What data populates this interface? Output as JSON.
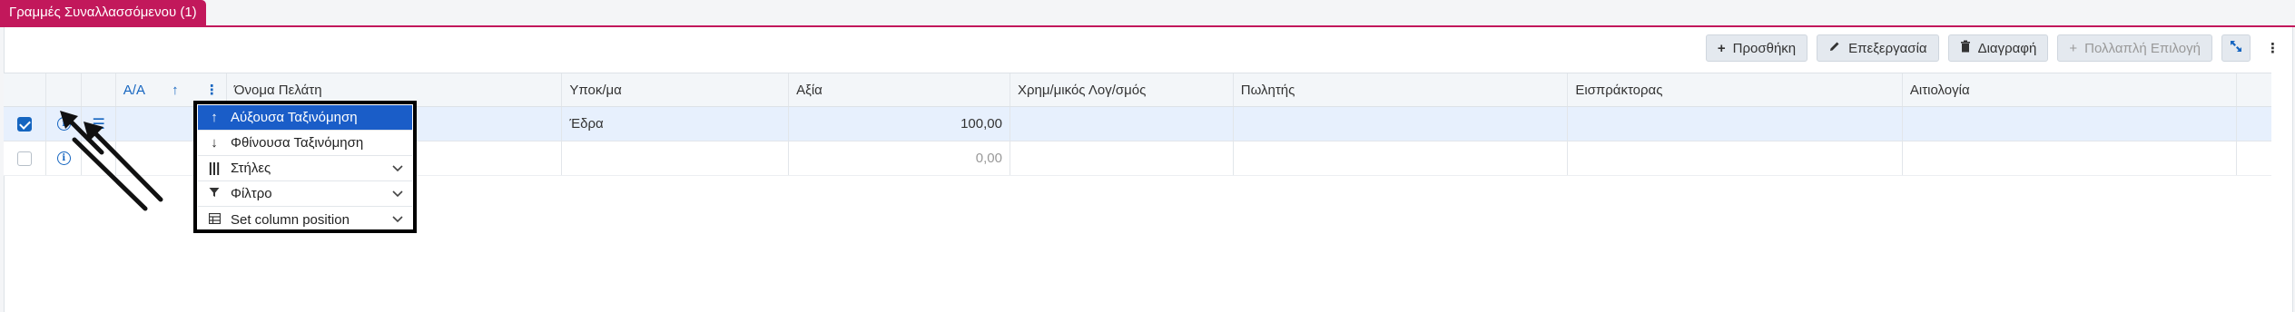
{
  "tab": {
    "label": "Γραμμές Συναλλασσόμενου (1)"
  },
  "toolbar": {
    "add_label": "Προσθήκη",
    "edit_label": "Επεξεργασία",
    "delete_label": "Διαγραφή",
    "multiselect_label": "Πολλαπλή Επιλογή"
  },
  "grid": {
    "headers": {
      "aa": "Α/Α",
      "customer_name": "Όνομα Πελάτη",
      "branch": "Υποκ/μα",
      "value": "Αξία",
      "financial_account": "Χρημ/μικός Λογ/σμός",
      "seller": "Πωλητής",
      "collector": "Εισπράκτορας",
      "reason": "Αιτιολογία"
    },
    "rows": [
      {
        "selected": true,
        "branch": "Έδρα",
        "value": "100,00"
      },
      {
        "selected": false,
        "branch": "",
        "value": "0,00"
      }
    ]
  },
  "column_menu": {
    "items": [
      {
        "label": "Αύξουσα Ταξινόμηση",
        "icon": "arrow-up-icon"
      },
      {
        "label": "Φθίνουσα Ταξινόμηση",
        "icon": "arrow-down-icon"
      },
      {
        "label": "Στήλες",
        "icon": "columns-icon"
      },
      {
        "label": "Φίλτρο",
        "icon": "filter-icon"
      },
      {
        "label": "Set column position",
        "icon": "table-icon"
      }
    ]
  },
  "colors": {
    "accent": "#c2185b",
    "primary": "#1565c0",
    "menu_active": "#1a5dc8"
  }
}
